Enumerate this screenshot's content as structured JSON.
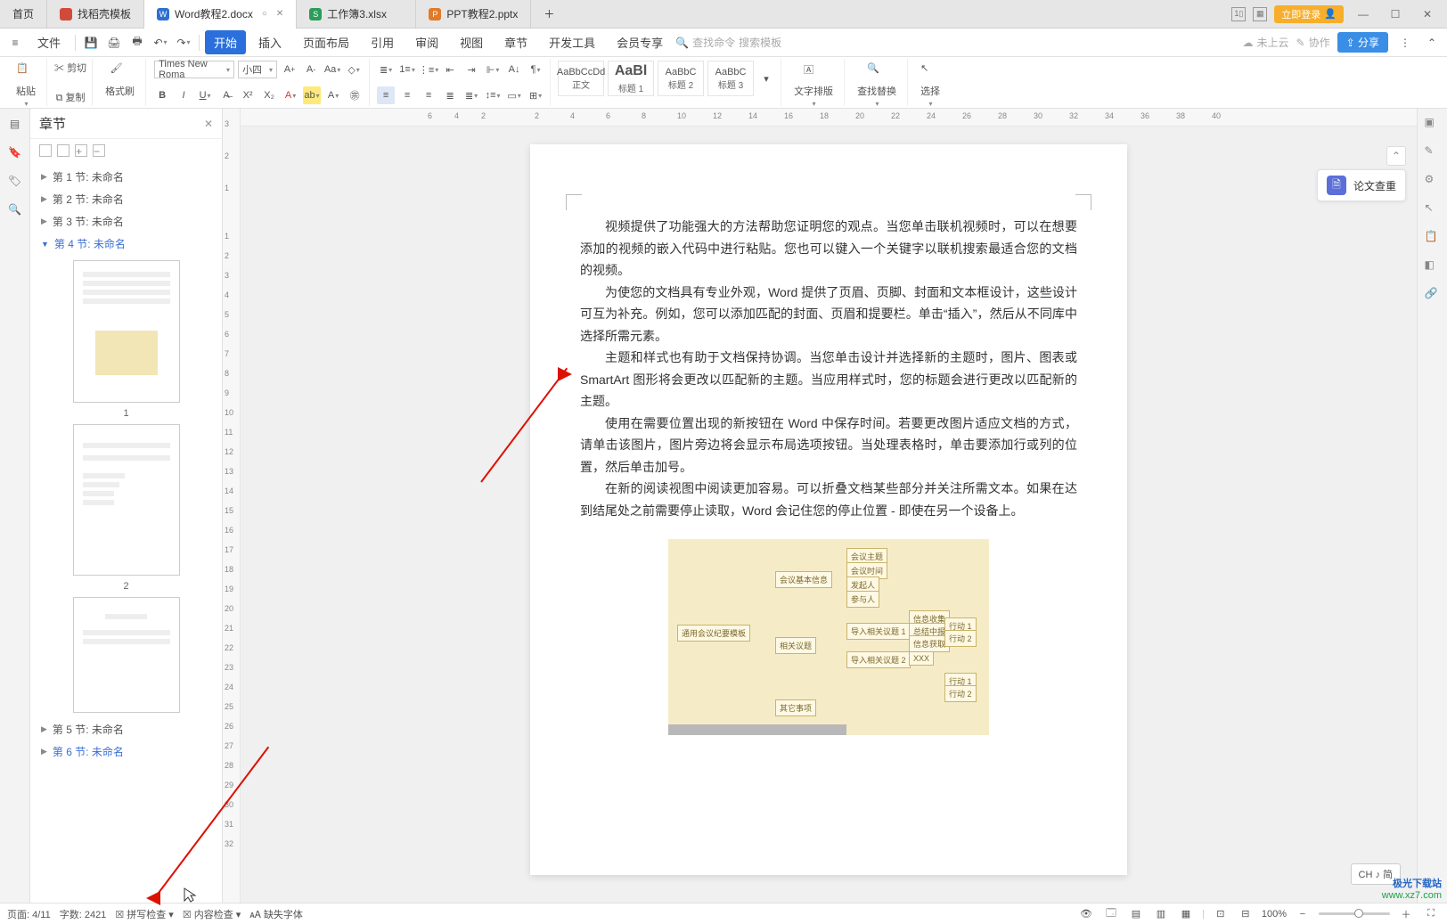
{
  "tabs": {
    "home": "首页",
    "t1": {
      "label": "找稻壳模板",
      "color": "#d24a3a"
    },
    "t2": {
      "label": "Word教程2.docx",
      "color": "#2f6fd0",
      "typeIcon": "W"
    },
    "t3": {
      "label": "工作簿3.xlsx",
      "color": "#2a9d5b",
      "typeIcon": "S"
    },
    "t4": {
      "label": "PPT教程2.pptx",
      "color": "#e07b2a",
      "typeIcon": "P"
    },
    "login": "立即登录"
  },
  "menu": {
    "file": "文件",
    "items": [
      "开始",
      "插入",
      "页面布局",
      "引用",
      "审阅",
      "视图",
      "章节",
      "开发工具",
      "会员专享"
    ],
    "activeIndex": 0,
    "searchPlaceholder": "查找命令",
    "searchTemplate": "搜索模板",
    "cloud": "未上云",
    "coop": "协作",
    "share": "分享"
  },
  "ribbon": {
    "paste": "粘贴",
    "cut": "剪切",
    "copy": "复制",
    "formatPainter": "格式刷",
    "fontName": "Times New Roma",
    "fontSize": "小四",
    "styles": [
      {
        "preview": "AaBbCcDd",
        "label": "正文"
      },
      {
        "preview": "AaBl",
        "label": "标题 1",
        "big": true
      },
      {
        "preview": "AaBbC",
        "label": "标题 2"
      },
      {
        "preview": "AaBbC",
        "label": "标题 3"
      }
    ],
    "textWrap": "文字排版",
    "findReplace": "查找替换",
    "select": "选择"
  },
  "side": {
    "title": "章节",
    "sections": [
      "第 1 节: 未命名",
      "第 2 节: 未命名",
      "第 3 节: 未命名",
      "第 4 节: 未命名",
      "第 5 节: 未命名",
      "第 6 节: 未命名"
    ],
    "activeIndex": 3,
    "thumbNums": [
      "1",
      "2"
    ]
  },
  "doc": {
    "p1": "视频提供了功能强大的方法帮助您证明您的观点。当您单击联机视频时，可以在想要添加的视频的嵌入代码中进行粘贴。您也可以键入一个关键字以联机搜索最适合您的文档的视频。",
    "p2": "为使您的文档具有专业外观，Word 提供了页眉、页脚、封面和文本框设计，这些设计可互为补充。例如，您可以添加匹配的封面、页眉和提要栏。单击“插入”，然后从不同库中选择所需元素。",
    "p3": "主题和样式也有助于文档保持协调。当您单击设计并选择新的主题时，图片、图表或 SmartArt 图形将会更改以匹配新的主题。当应用样式时，您的标题会进行更改以匹配新的主题。",
    "p4": "使用在需要位置出现的新按钮在 Word 中保存时间。若要更改图片适应文档的方式，请单击该图片，图片旁边将会显示布局选项按钮。当处理表格时，单击要添加行或列的位置，然后单击加号。",
    "p5": "在新的阅读视图中阅读更加容易。可以折叠文档某些部分并关注所需文本。如果在达到结尾处之前需要停止读取，Word 会记住您的停止位置 - 即使在另一个设备上。"
  },
  "diagram": {
    "root": "通用会议纪要模板",
    "n1": "会议基本信息",
    "n2": "相关议题",
    "n3": "其它事项",
    "leafs": [
      "会议主题",
      "会议时间",
      "发起人",
      "参与人",
      "导入相关议题 1",
      "导入相关议题 2",
      "信息收集",
      "总结中报告",
      "信息获取",
      "XXX",
      "行动 1",
      "行动 2",
      "行动 1",
      "行动 2"
    ]
  },
  "floating": {
    "paperCheck": "论文查重"
  },
  "ime": "CH ♪ 简",
  "status": {
    "page": "页面: 4/11",
    "words": "字数: 2421",
    "spell": "拼写检查",
    "content": "内容检查",
    "missingFont": "缺失字体",
    "zoom": "100%"
  },
  "watermark": {
    "l1": "极光下载站",
    "l2": "www.xz7.com"
  }
}
